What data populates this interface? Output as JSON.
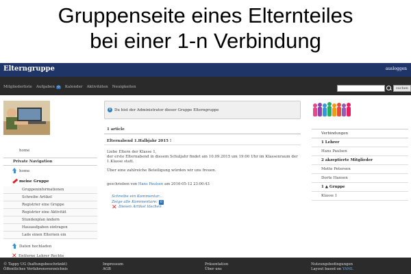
{
  "slide": {
    "title_line1": "Gruppenseite eines Elternteiles",
    "title_line2": "bei einer 1-n Verbindung"
  },
  "header": {
    "brand": "Elterngruppe",
    "logout": "ausloggen"
  },
  "nav": {
    "items": [
      "Mitgliederliste",
      "Aufgaben",
      "Kalender",
      "Aktivitäten",
      "Neuigkeiten"
    ],
    "tasks_badge": "0"
  },
  "search": {
    "value": "",
    "button": "suchen"
  },
  "sidebar": {
    "home": "home",
    "private_nav": "Private Navigation",
    "my_group": "meine Gruppe",
    "subitems": [
      "Gruppeninformationen",
      "Schreibe Artikel",
      "Registrier eine Gruppe",
      "Registrier eine Aktivität",
      "Stundenplan ändern",
      "Hausaufgaben eintragen",
      "Lade einen Elternen ein"
    ],
    "close_data": "Daten hochladen",
    "remove_rights": "Entferne Lehrer Rechte"
  },
  "main": {
    "info": "Du bist der Administrator dieser Gruppe Elterngruppe",
    "article_count": "1 article",
    "article_title": "Elternabend 1.Halbjahr 2015 !",
    "body": {
      "greeting": "Liebe Eltern der Klasse 1,",
      "line1": "der erste Elternabend in diesem Schuljahr findet am 10.09.2015 um 19:00 Uhr im Klassenraum der",
      "line2": "1.Klasse statt.",
      "line3": "Über eine zahlreiche Beteiligung würden wir uns freuen."
    },
    "byline_prefix": "geschrieben von ",
    "byline_author": "Hans Paulsen",
    "byline_suffix": "am 2016-05-12 23:00:43",
    "write_comment": "Schreibe ein Kommentar...",
    "show_comments": "Zeige alle Kommentare:",
    "comments_badge": "0",
    "delete_article": "Diesen Artikel löschen"
  },
  "right": {
    "heading": "Verbindungen",
    "rows": [
      {
        "text": "1 Lehrer",
        "bold": true
      },
      {
        "text": "Hans Paulsen",
        "bold": false
      },
      {
        "text": "2 akzeptierte Mitglieder",
        "bold": true
      },
      {
        "text": "Mette Petersen",
        "bold": false
      },
      {
        "text": "Dorte Hansen",
        "bold": false
      },
      {
        "text": "1 ▲ Gruppe",
        "bold": true
      },
      {
        "text": "Klasse 1",
        "bold": false
      }
    ]
  },
  "footer": {
    "col1_line1": "© Tappy UG (haftungsbeschränkt)",
    "col1_line2": "Öffentliches Verfahrensverzeichnis",
    "col2_line1": "Impressum",
    "col2_line2": "AGB",
    "col3_line1": "Präsentation",
    "col3_line2": "Über uns",
    "col4_line1": "Nutzungsbedingungen",
    "col4_prefix": "Layout based on ",
    "col4_link": "YAML"
  },
  "colors": {
    "header_bg": "#1f3567",
    "nav_bg": "#2a2a2a",
    "footer_bg": "#2b2b2b",
    "link": "#2f6fb5",
    "delete_red": "#dd2222"
  }
}
